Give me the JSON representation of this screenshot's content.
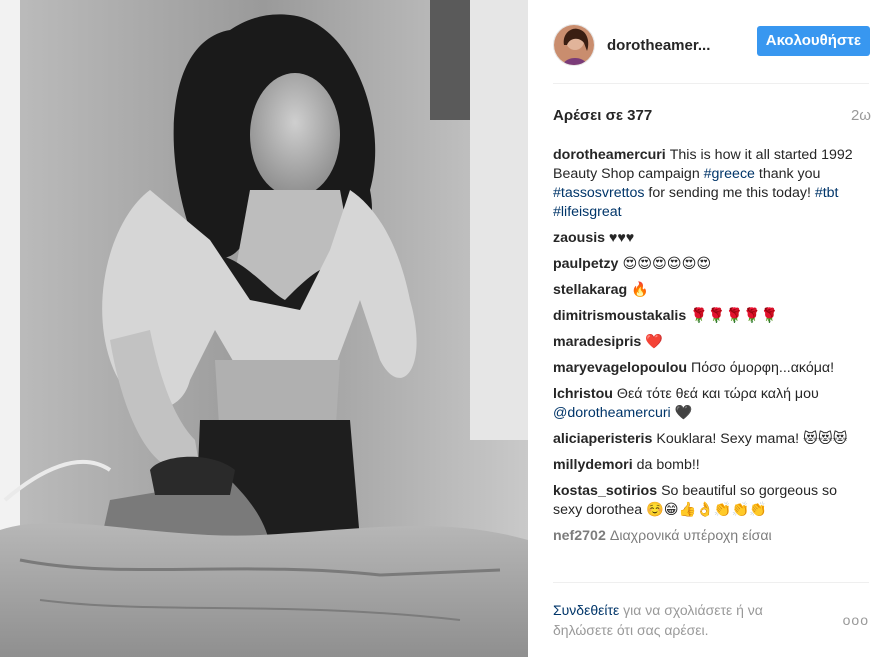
{
  "post": {
    "username": "dorotheamer...",
    "follow_label": "Ακολουθήστε",
    "likes": "Αρέσει σε 377",
    "time": "2ω"
  },
  "caption": {
    "user": "dorotheamercuri",
    "text_1": "This is how it all started 1992 Beauty Shop campaign ",
    "tag_1": "#greece",
    "text_2": " thank you ",
    "tag_2": "#tassosvrettos",
    "text_3": " for sending me this today! ",
    "tag_3": "#tbt",
    "text_4": " ",
    "tag_4": "#lifeisgreat"
  },
  "comments": [
    {
      "user": "zaousis",
      "text": "♥♥♥"
    },
    {
      "user": "paulpetzy",
      "text": "😍😍😍😍😍😍"
    },
    {
      "user": "stellakarag",
      "text": "🔥"
    },
    {
      "user": "dimitrismoustakalis",
      "text": "🌹🌹🌹🌹🌹"
    },
    {
      "user": "maradesipris",
      "text": "❤️"
    },
    {
      "user": "maryevagelopoulou",
      "text": "Πόσο όμορφη...ακόμα!"
    },
    {
      "user": "lchristou",
      "text": "Θεά τότε θεά και τώρα καλή μου ",
      "mention": "@dorotheamercuri",
      "after": " 🖤"
    },
    {
      "user": "aliciaperisteris",
      "text": "Kouklara! Sexy mama! 😻😻😻"
    },
    {
      "user": "millydemori",
      "text": "da bomb!!"
    },
    {
      "user": "kostas_sotirios",
      "text": "So beautiful so gorgeous so sexy dorothea ☺️😁👍👌👏👏👏"
    },
    {
      "user": "nef2702",
      "text": "Διαχρονικά υπέροχη είσαι"
    }
  ],
  "footer": {
    "login_label": "Συνδεθείτε",
    "text": " για να σχολιάσετε ή να δηλώσετε ότι σας αρέσει.",
    "more_label": "ooo"
  },
  "icons": {
    "more": "more-options-icon"
  },
  "colors": {
    "follow_button": "#3897f0",
    "link": "#003569",
    "muted": "#999999"
  }
}
